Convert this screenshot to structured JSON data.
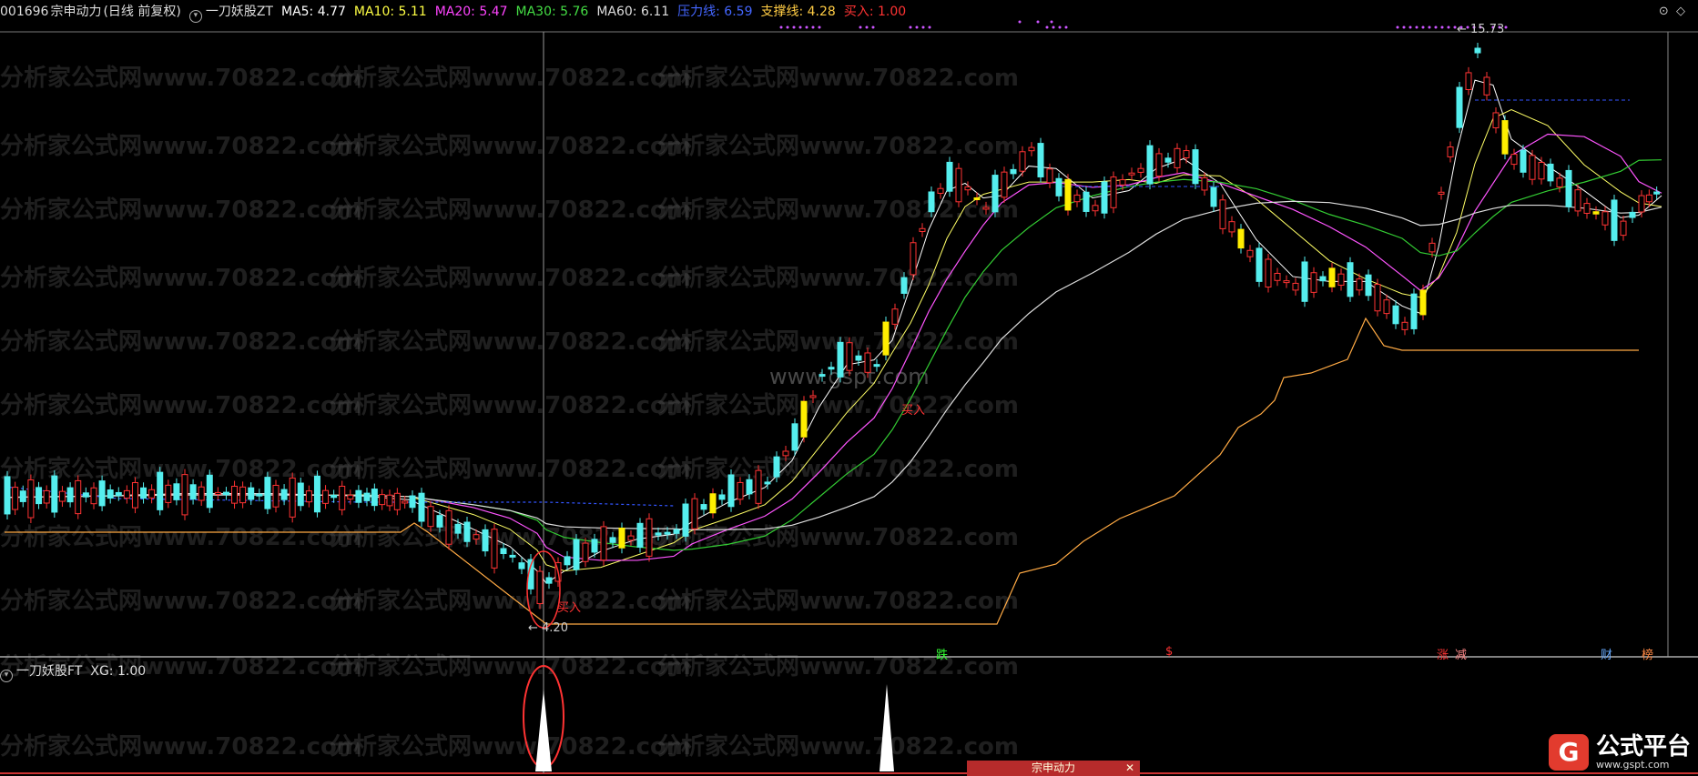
{
  "header": {
    "code": "001696",
    "name": "宗申动力",
    "mode": "(日线 前复权)",
    "indicator": "一刀妖股ZT",
    "ma5": "MA5: 4.77",
    "ma10": "MA10: 5.11",
    "ma20": "MA20: 5.47",
    "ma30": "MA30: 5.76",
    "ma60": "MA60: 6.11",
    "pressure": "压力线: 6.59",
    "support": "支撑线: 4.28",
    "buy": "买入: 1.00"
  },
  "sub_header": {
    "indicator": "一刀妖股FT",
    "xg": "XG: 1.00"
  },
  "labels": {
    "high_price": "15.73",
    "low_price": "4.20",
    "buy_1": "买入",
    "buy_2": "买入",
    "watermark": "分析家公式网www.70822.com",
    "site": "www.gspt.com",
    "sig_die": "跌",
    "sig_s": "$",
    "sig_zhang": "涨",
    "sig_jian": "减",
    "sig_cai": "财",
    "sig_bang": "榜",
    "tab": "宗申动力",
    "tab_close": "✕",
    "logo_mark": "G",
    "logo_title": "公式平台",
    "logo_url": "www.gspt.com"
  },
  "colors": {
    "ma5": "#ffffff",
    "ma10": "#ffff66",
    "ma20": "#ff55ff",
    "ma30": "#33cc33",
    "ma60": "#dddddd",
    "pressure": "#3355ff",
    "support": "#ffaa44",
    "up": "#ff3333",
    "down": "#55eeee",
    "signal": "#ffee00"
  },
  "chart_data": {
    "type": "candlestick",
    "price_range": [
      4.2,
      15.73
    ],
    "notes": "Daily K-line of 001696 with MA5/10/20/30/60, pressure and support lines; lower pane shows XG buy signal spikes",
    "xg_signals": [
      1,
      1
    ]
  }
}
